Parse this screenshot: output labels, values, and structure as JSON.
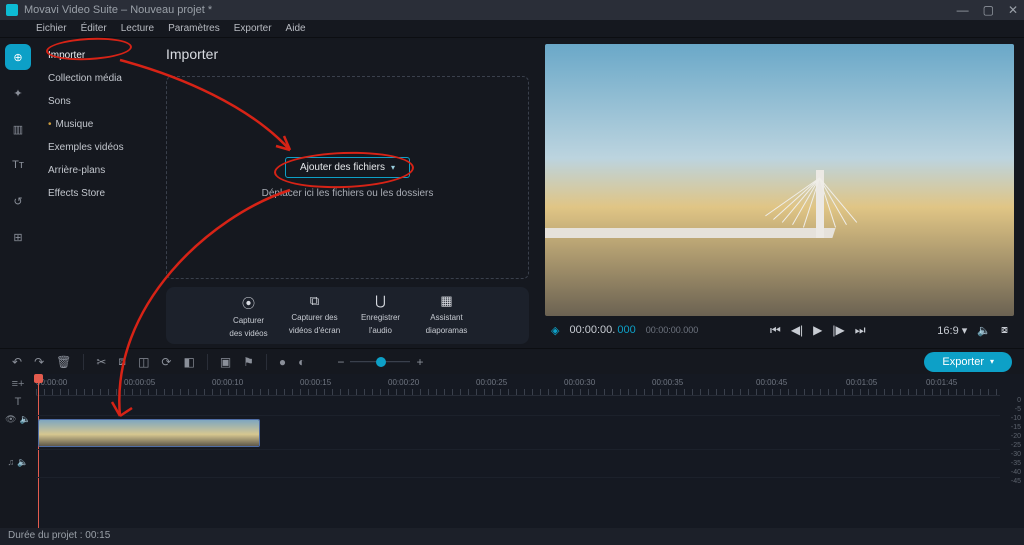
{
  "window": {
    "title": "Movavi Video Suite – Nouveau projet *"
  },
  "menubar": [
    "Eichier",
    "Éditer",
    "Lecture",
    "Paramètres",
    "Exporter",
    "Aide"
  ],
  "leftrail": [
    {
      "name": "import-icon",
      "glyph": "⊕",
      "active": true
    },
    {
      "name": "filters-icon",
      "glyph": "✦"
    },
    {
      "name": "transitions-icon",
      "glyph": "▥"
    },
    {
      "name": "titles-icon",
      "glyph": "Tᴛ"
    },
    {
      "name": "history-icon",
      "glyph": "↺"
    },
    {
      "name": "more-icon",
      "glyph": "⊞"
    }
  ],
  "sidebar": {
    "items": [
      {
        "label": "Importer",
        "selected": true
      },
      {
        "label": "Collection média"
      },
      {
        "label": "Sons"
      },
      {
        "label": "Musique",
        "mark": true
      },
      {
        "label": "Exemples vidéos"
      },
      {
        "label": "Arrière-plans"
      },
      {
        "label": "Effects Store"
      }
    ]
  },
  "center": {
    "heading": "Importer",
    "add_label": "Ajouter des fichiers",
    "drop_label": "Déplacer ici les fichiers ou les dossiers",
    "capture": [
      {
        "icon": "⦿",
        "label1": "Capturer",
        "label2": "des vidéos",
        "name": "capture-video"
      },
      {
        "icon": "⧉",
        "label1": "Capturer des",
        "label2": "vidéos d'écran",
        "name": "capture-screen"
      },
      {
        "icon": "⋃",
        "label1": "Enregistrer",
        "label2": "l'audio",
        "name": "record-audio"
      },
      {
        "icon": "▦",
        "label1": "Assistant",
        "label2": "diaporamas",
        "name": "slideshow-wizard"
      }
    ]
  },
  "preview": {
    "timecode": "00:00:00",
    "frames": "000",
    "fulltc": "00:00:00.000",
    "aspect": "16:9"
  },
  "toolbar": {
    "export_label": "Exporter"
  },
  "timeline": {
    "ruler": [
      "00:00:00",
      "00:00:05",
      "00:00:10",
      "00:00:15",
      "00:00:20",
      "00:00:25",
      "00:00:30",
      "00:00:35",
      "00:00:45",
      "00:01:05",
      "00:01:45"
    ]
  },
  "meters": [
    "0",
    "-5",
    "-10",
    "-15",
    "-20",
    "-25",
    "-30",
    "-35",
    "-40",
    "-45"
  ],
  "status": {
    "text": "Durée du projet : 00:15"
  }
}
